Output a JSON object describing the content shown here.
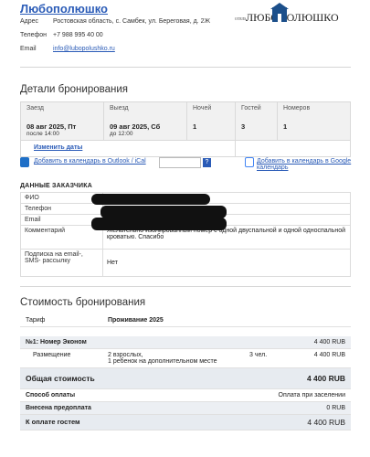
{
  "header": {
    "hotel_name": "Любополюшко",
    "address_label": "Адрес",
    "address": "Ростовская область, с. Самбек, ул. Береговая, д. 2Ж",
    "phone_label": "Телефон",
    "phone": "+7 988 995 40 00",
    "email_label": "Email",
    "email": "info@lubopolushko.ru",
    "logo_text": "ОТЕЛЬ ЛЮБОПОЛЮШКО"
  },
  "booking": {
    "title": "Детали бронирования",
    "checkin_label": "Заезд",
    "checkin_date": "08 авг 2025, Пт",
    "checkin_time": "после 14:00",
    "checkout_label": "Выезд",
    "checkout_date": "09 авг 2025, Сб",
    "checkout_time": "до 12:00",
    "nights_label": "Ночей",
    "nights": "1",
    "guests_label": "Гостей",
    "guests": "3",
    "rooms_label": "Номеров",
    "rooms": "1",
    "change_dates": "Изменить даты"
  },
  "calendar": {
    "outlook": "Добавить в календарь в Outlook / iCal",
    "google": "Добавить в календарь в Google календарь",
    "help": "?"
  },
  "customer": {
    "section_title": "ДАННЫЕ ЗАКАЗЧИКА",
    "rows": [
      {
        "k": "ФИО",
        "v": ""
      },
      {
        "k": "Телефон",
        "v": ""
      },
      {
        "k": "Email",
        "v": ""
      },
      {
        "k": "Комментарий",
        "v": "Желательно изолированный номер с одной двуспальной и одной односпальной кроватью. Спасибо"
      },
      {
        "k": "Подписка на email-, SMS- рассылку",
        "v": "Нет"
      }
    ]
  },
  "cost": {
    "title": "Стоимость бронирования",
    "tariff_label": "Тариф",
    "tariff": "Проживание 2025",
    "room_line": "№1: Номер Эконом",
    "room_price": "4 400 RUB",
    "placement_label": "Размещение",
    "placement_text": "2 взрослых,\n1 ребенок на дополнительном месте",
    "placement_count": "3 чел.",
    "placement_price": "4 400 RUB",
    "total_label": "Общая стоимость",
    "total": "4 400 RUB",
    "payment_label": "Способ оплаты",
    "payment": "Оплата при заселении",
    "prepaid_label": "Внесена предоплата",
    "prepaid": "0 RUB",
    "due_label": "К оплате гостем",
    "due": "4 400 RUB"
  }
}
